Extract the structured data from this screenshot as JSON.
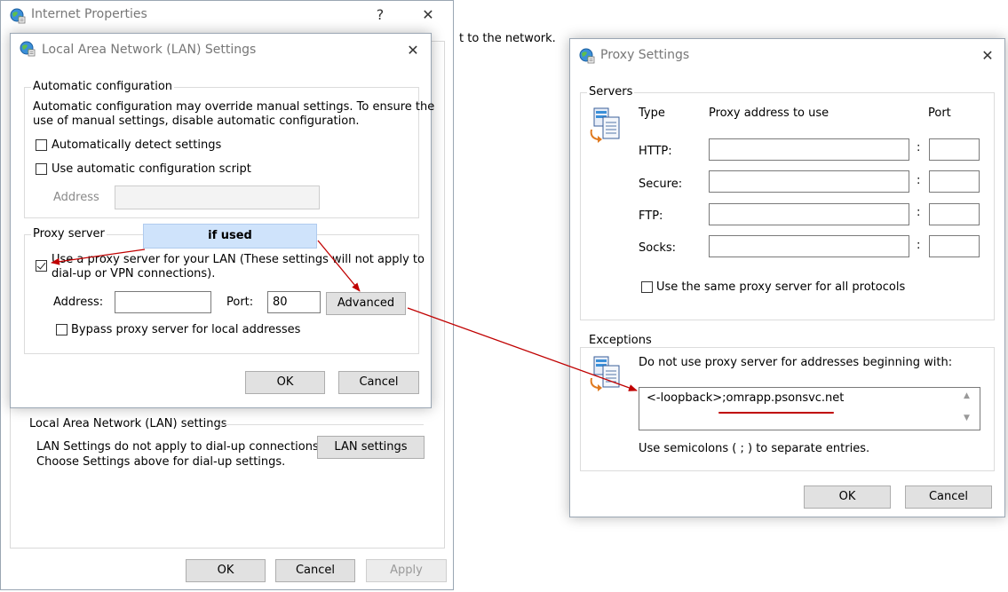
{
  "icons": {
    "internet_options": "internet-options-globe-icon",
    "servers": "network-servers-icon",
    "exceptions": "network-servers-icon"
  },
  "background_text": "t to the network.",
  "internet_properties": {
    "title": "Internet Properties",
    "help": "?",
    "close": "✕",
    "lan_section": {
      "title": "Local Area Network (LAN) settings",
      "description_line1": "LAN Settings do not apply to dial-up connections.",
      "description_line2": "Choose Settings above for dial-up settings.",
      "lan_settings_button": "LAN settings"
    },
    "buttons": {
      "ok": "OK",
      "cancel": "Cancel",
      "apply": "Apply"
    }
  },
  "lan_dialog": {
    "title": "Local Area Network (LAN) Settings",
    "close": "✕",
    "auto_config": {
      "group_title": "Automatic configuration",
      "description_line1": "Automatic configuration may override manual settings.  To ensure the",
      "description_line2": "use of manual settings, disable automatic configuration.",
      "auto_detect_label": "Automatically detect settings",
      "auto_detect_checked": false,
      "use_script_label": "Use automatic configuration script",
      "use_script_checked": false,
      "address_label": "Address",
      "address_value": ""
    },
    "proxy_server": {
      "group_title": "Proxy server",
      "use_proxy_label_line1": "Use a proxy server for your LAN (These settings will not apply to",
      "use_proxy_label_line2": "dial-up or VPN connections).",
      "use_proxy_checked": true,
      "address_label": "Address:",
      "address_value": "",
      "port_label": "Port:",
      "port_value": "80",
      "advanced_button": "Advanced",
      "bypass_label": "Bypass proxy server for local addresses",
      "bypass_checked": false
    },
    "buttons": {
      "ok": "OK",
      "cancel": "Cancel"
    }
  },
  "callout": {
    "text": "if used",
    "color": "#cfe3fb"
  },
  "annotation_color": "#c00000",
  "proxy_settings": {
    "title": "Proxy Settings",
    "close": "✕",
    "servers": {
      "group_title": "Servers",
      "col_type": "Type",
      "col_address": "Proxy address to use",
      "col_port": "Port",
      "rows": [
        {
          "type": "HTTP:",
          "address": "",
          "port": ""
        },
        {
          "type": "Secure:",
          "address": "",
          "port": ""
        },
        {
          "type": "FTP:",
          "address": "",
          "port": ""
        },
        {
          "type": "Socks:",
          "address": "",
          "port": ""
        }
      ],
      "colon": ":",
      "same_proxy_label": "Use the same proxy server for all protocols",
      "same_proxy_checked": false
    },
    "exceptions": {
      "group_title": "Exceptions",
      "description": "Do not use proxy server for addresses beginning with:",
      "value_prefix": "<-loopback>;",
      "value_highlight": "omrapp.psonsvc.net",
      "hint": "Use semicolons ( ; ) to separate entries."
    },
    "buttons": {
      "ok": "OK",
      "cancel": "Cancel"
    }
  }
}
